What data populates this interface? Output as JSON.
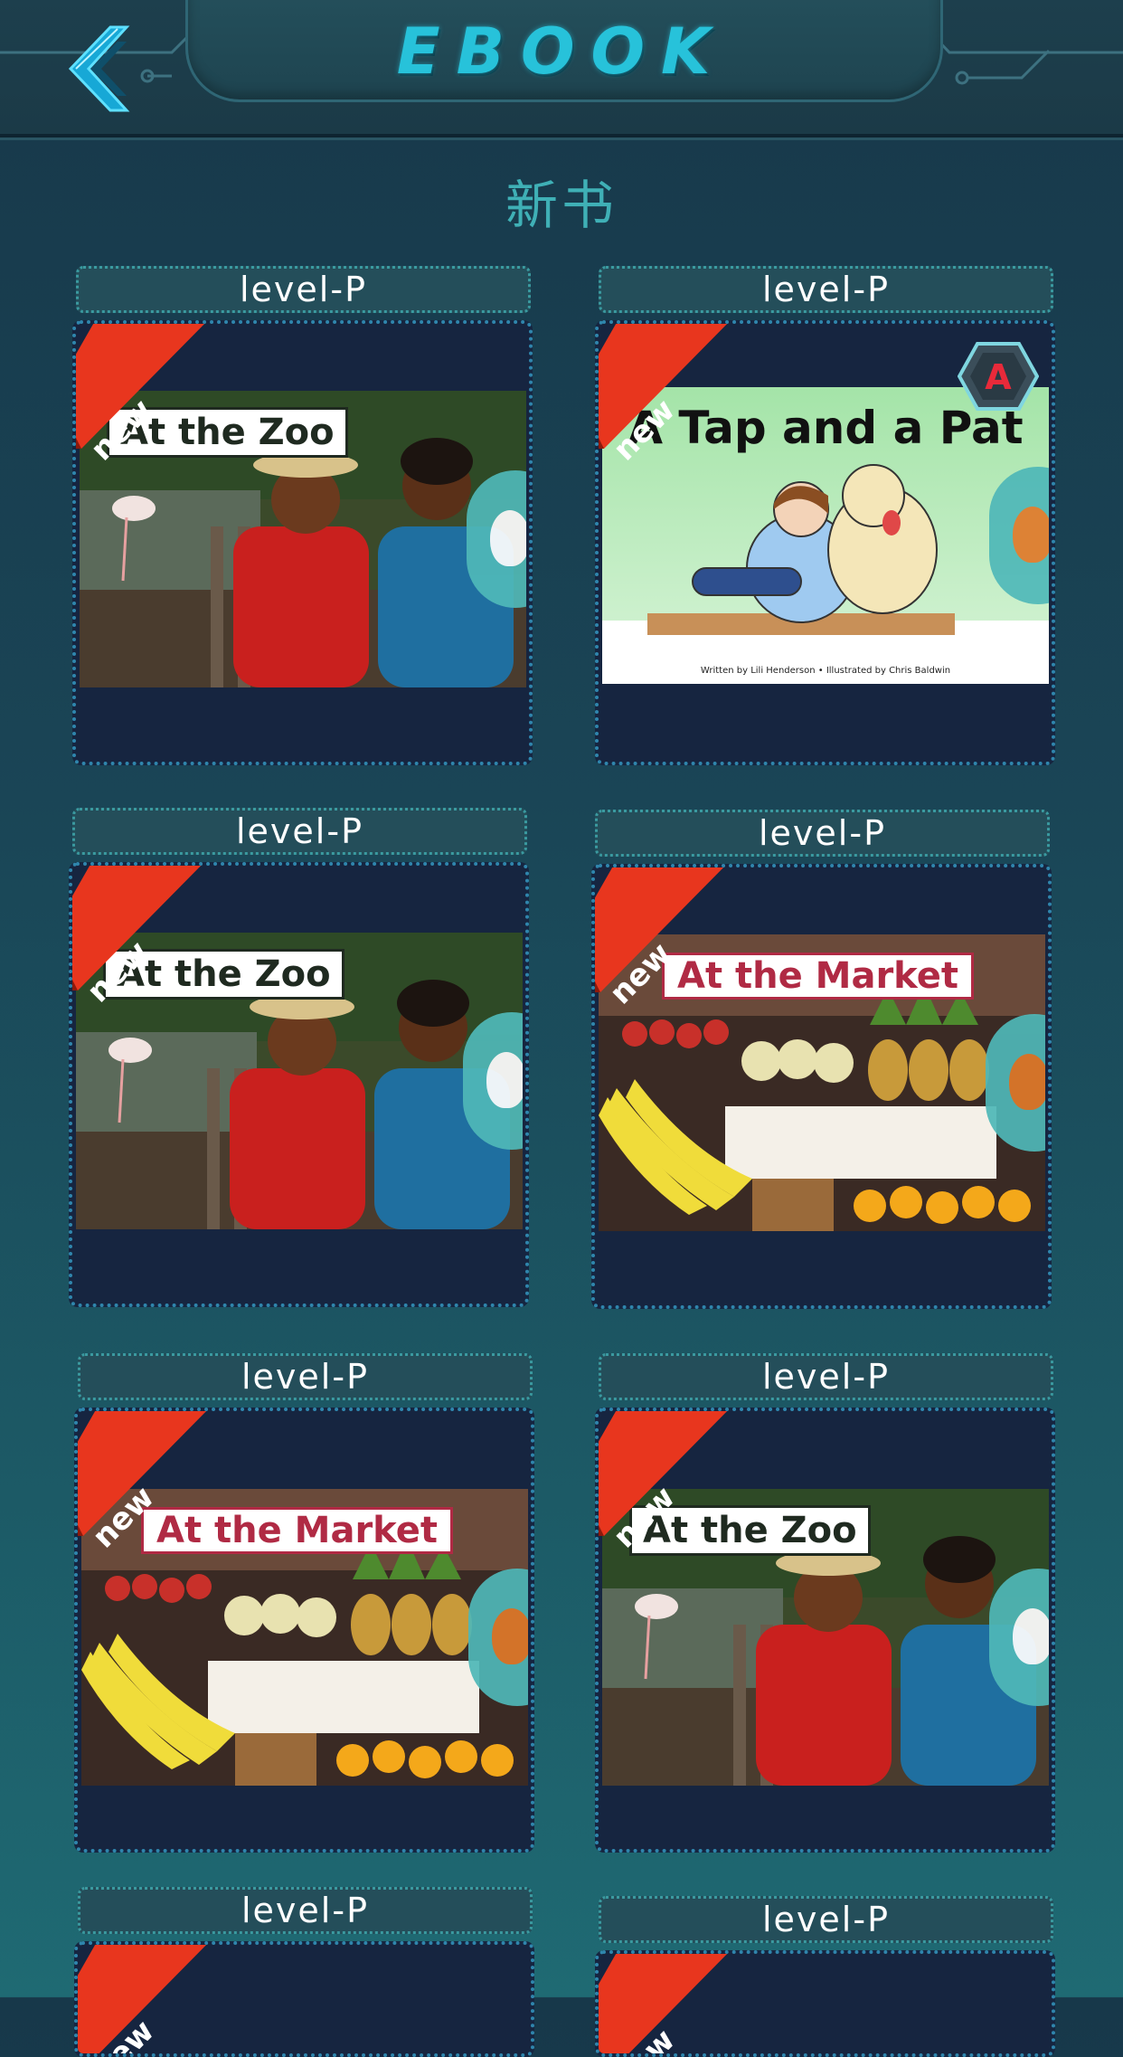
{
  "header": {
    "title": "EBOOK",
    "back_icon": "chevron-left-icon"
  },
  "section": {
    "title": "新书"
  },
  "badges": {
    "new_label": "new",
    "level_letter": "A"
  },
  "colors": {
    "accent": "#27c2da",
    "ribbon": "#e8361e",
    "listen_played": "#ffffff",
    "listen_unplayed": "#e07a2a"
  },
  "books": [
    {
      "level": "level-P",
      "title": "At the Zoo",
      "cover": "zoo",
      "listen_state": "played"
    },
    {
      "level": "level-P",
      "title": "A Tap and a Pat",
      "cover": "tap",
      "credits": "Written by Lili Henderson • Illustrated by Chris Baldwin",
      "listen_state": "unplayed",
      "has_level_badge": true
    },
    {
      "level": "level-P",
      "title": "At the Zoo",
      "cover": "zoo",
      "listen_state": "played"
    },
    {
      "level": "level-P",
      "title": "At the Market",
      "cover": "market",
      "listen_state": "unplayed"
    },
    {
      "level": "level-P",
      "title": "At the Market",
      "cover": "market",
      "listen_state": "unplayed"
    },
    {
      "level": "level-P",
      "title": "At the Zoo",
      "cover": "zoo",
      "listen_state": "played"
    },
    {
      "level": "level-P",
      "title": "",
      "cover": "partial",
      "listen_state": "unknown"
    },
    {
      "level": "level-P",
      "title": "",
      "cover": "partial",
      "listen_state": "unknown"
    }
  ]
}
